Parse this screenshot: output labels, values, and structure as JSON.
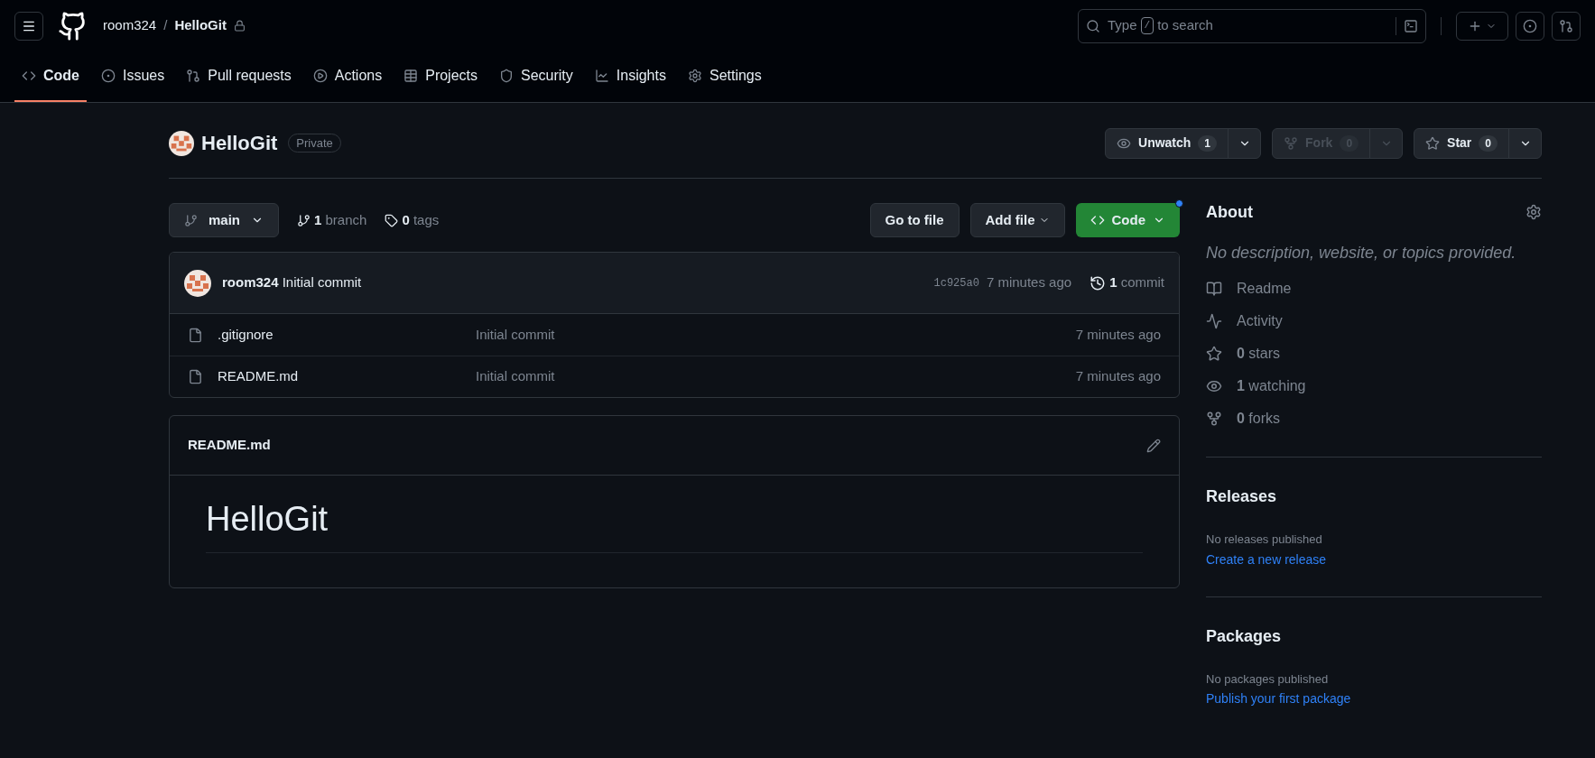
{
  "header": {
    "owner": "room324",
    "separator": "/",
    "repo": "HelloGit",
    "search": {
      "before": "Type",
      "key": "/",
      "after": "to search"
    }
  },
  "nav": [
    {
      "label": "Code",
      "kind": "code",
      "selected": true
    },
    {
      "label": "Issues",
      "kind": "issues",
      "selected": false
    },
    {
      "label": "Pull requests",
      "kind": "pulls",
      "selected": false
    },
    {
      "label": "Actions",
      "kind": "actions",
      "selected": false
    },
    {
      "label": "Projects",
      "kind": "projects",
      "selected": false
    },
    {
      "label": "Security",
      "kind": "security",
      "selected": false
    },
    {
      "label": "Insights",
      "kind": "insights",
      "selected": false
    },
    {
      "label": "Settings",
      "kind": "settings",
      "selected": false
    }
  ],
  "repo": {
    "name": "HelloGit",
    "visibility": "Private",
    "actions": [
      {
        "kind": "watch",
        "label": "Unwatch",
        "count": "1",
        "disabled": false
      },
      {
        "kind": "fork",
        "label": "Fork",
        "count": "0",
        "disabled": true
      },
      {
        "kind": "star",
        "label": "Star",
        "count": "0",
        "disabled": false
      }
    ]
  },
  "toolbar": {
    "branch": "main",
    "branch_count": "1",
    "branch_label": "branch",
    "tag_count": "0",
    "tag_label": "tags",
    "go_to_file": "Go to file",
    "add_file": "Add file",
    "code": "Code"
  },
  "commit": {
    "author": "room324",
    "message": "Initial commit",
    "hash": "1c925a0",
    "time": "7 minutes ago",
    "count": "1",
    "count_label": "commit"
  },
  "files": [
    {
      "name": ".gitignore",
      "message": "Initial commit",
      "time": "7 minutes ago"
    },
    {
      "name": "README.md",
      "message": "Initial commit",
      "time": "7 minutes ago"
    }
  ],
  "readme": {
    "title": "README.md",
    "heading": "HelloGit"
  },
  "about": {
    "title": "About",
    "description": "No description, website, or topics provided.",
    "items": [
      {
        "kind": "readme",
        "label": "Readme"
      },
      {
        "kind": "activity",
        "label": "Activity"
      },
      {
        "kind": "stars",
        "count": "0",
        "label": "stars"
      },
      {
        "kind": "watching",
        "count": "1",
        "label": "watching"
      },
      {
        "kind": "forks",
        "count": "0",
        "label": "forks"
      }
    ]
  },
  "releases": {
    "title": "Releases",
    "note": "No releases published",
    "link": "Create a new release"
  },
  "packages": {
    "title": "Packages",
    "note": "No packages published",
    "link": "Publish your first package"
  }
}
